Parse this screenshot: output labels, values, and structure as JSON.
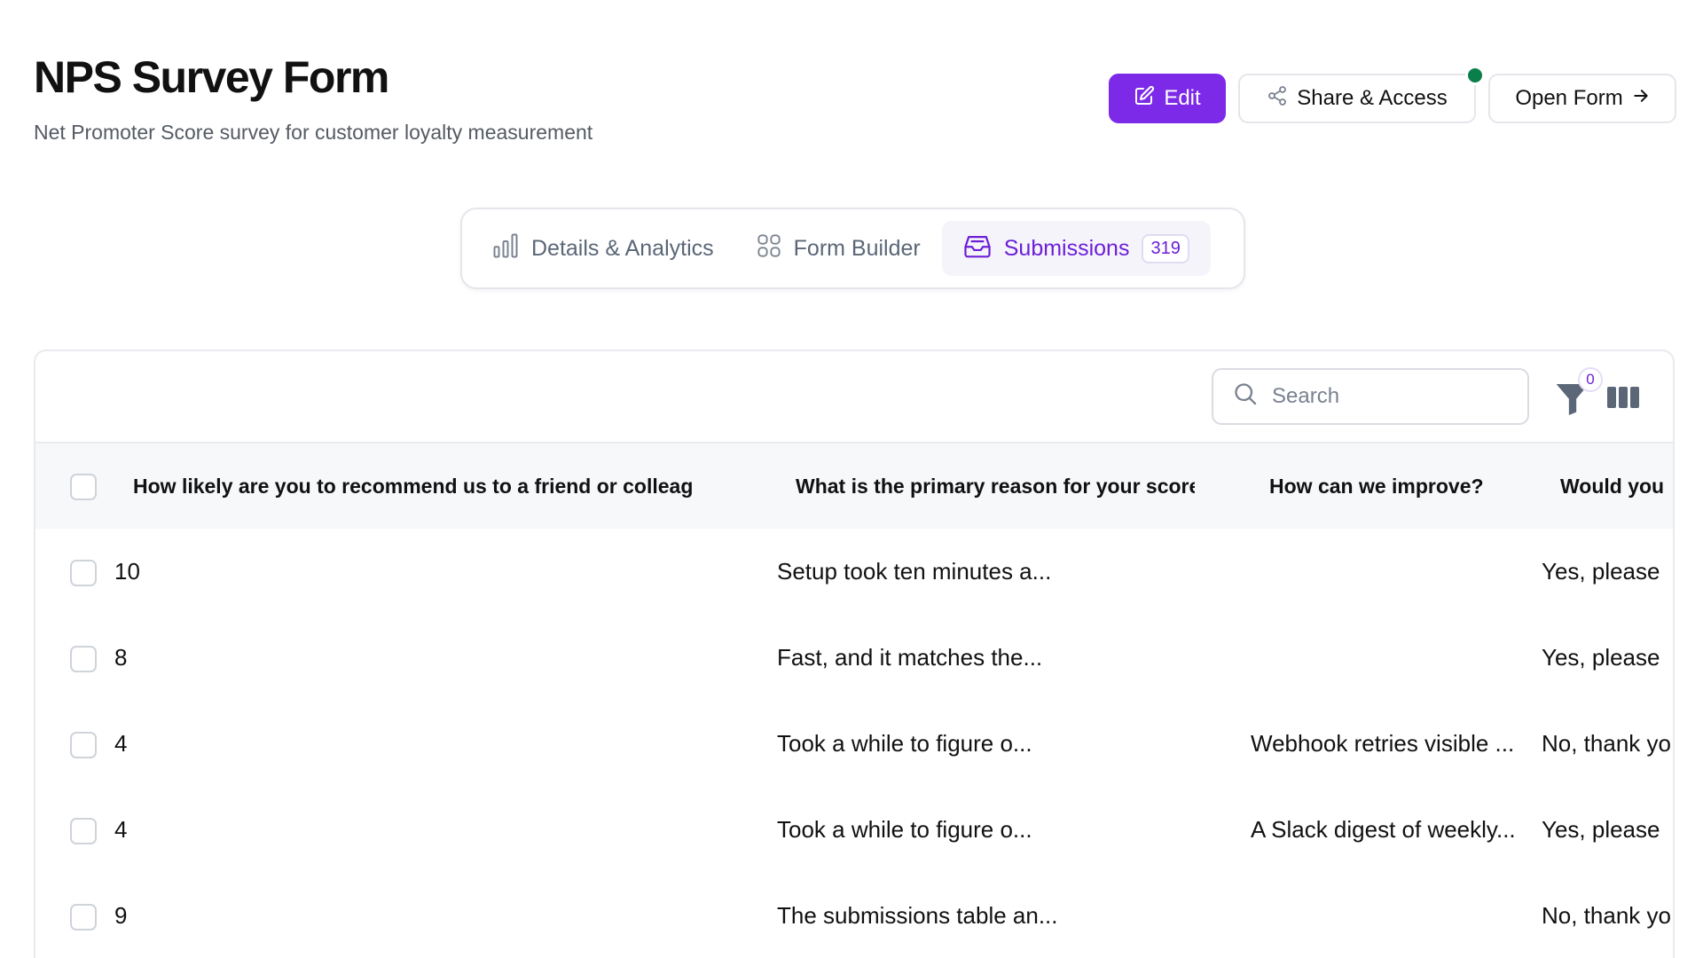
{
  "header": {
    "title": "NPS Survey Form",
    "subtitle": "Net Promoter Score survey for customer loyalty measurement"
  },
  "actions": {
    "edit_label": "Edit",
    "share_label": "Share & Access",
    "open_label": "Open Form",
    "live_status_color": "#0a7f4a"
  },
  "tabs": [
    {
      "label": "Details & Analytics",
      "icon": "bar-chart-icon"
    },
    {
      "label": "Form Builder",
      "icon": "grid-icon"
    },
    {
      "label": "Submissions",
      "icon": "inbox-icon",
      "count": "319",
      "active": true
    }
  ],
  "toolbar": {
    "search_placeholder": "Search",
    "filter_count": "0"
  },
  "table": {
    "columns": [
      "How likely are you to recommend us to a friend or colleague?",
      "What is the primary reason for your score?",
      "How can we improve?",
      "Would you"
    ],
    "rows": [
      [
        "10",
        "Setup took ten minutes a...",
        "",
        "Yes, please"
      ],
      [
        "8",
        "Fast, and it matches the...",
        "",
        "Yes, please"
      ],
      [
        "4",
        "Took a while to figure o...",
        "Webhook retries visible ...",
        "No, thank yo"
      ],
      [
        "4",
        "Took a while to figure o...",
        "A Slack digest of weekly...",
        "Yes, please"
      ],
      [
        "9",
        "The submissions table an...",
        "",
        "No, thank yo"
      ]
    ]
  },
  "colors": {
    "accent": "#7c2ae8",
    "accent_text": "#6b1fd6"
  }
}
